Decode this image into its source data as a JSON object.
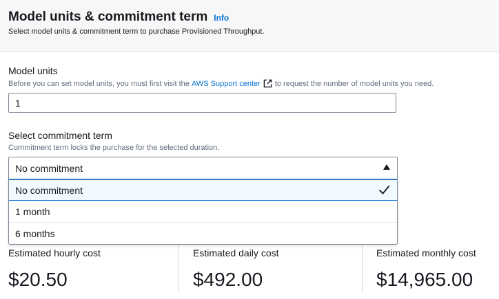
{
  "header": {
    "title": "Model units & commitment term",
    "info_link": "Info",
    "subtitle": "Select model units & commitment term to purchase Provisioned Throughput."
  },
  "model_units": {
    "label": "Model units",
    "desc_before": "Before you can set model units, you must first visit the",
    "desc_link": "AWS Support center",
    "desc_after": "to request the number of model units you need.",
    "value": "1"
  },
  "commitment": {
    "label": "Select commitment term",
    "desc": "Commitment term locks the purchase for the selected duration.",
    "selected": "No commitment",
    "options": [
      "No commitment",
      "1 month",
      "6 months"
    ]
  },
  "costs": [
    {
      "label": "Estimated hourly cost",
      "value": "$20.50"
    },
    {
      "label": "Estimated daily cost",
      "value": "$492.00"
    },
    {
      "label": "Estimated monthly cost",
      "value": "$14,965.00"
    }
  ],
  "colors": {
    "link": "#0972d3",
    "selected_bg": "#f1faff",
    "header_bg": "#f7f7f8"
  }
}
